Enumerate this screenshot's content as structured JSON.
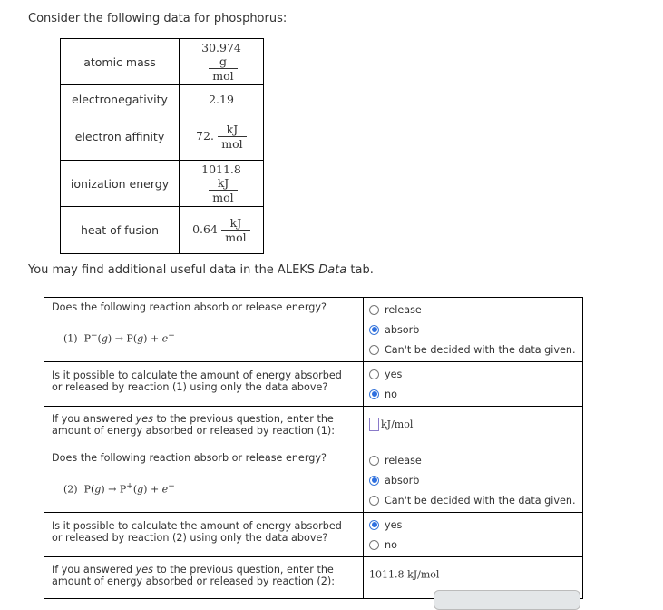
{
  "intro": "Consider the following data for phosphorus:",
  "data_table": [
    {
      "label": "atomic mass",
      "value": "30.974",
      "unit_num": "g",
      "unit_den": "mol"
    },
    {
      "label": "electronegativity",
      "value": "2.19",
      "unit_num": "",
      "unit_den": ""
    },
    {
      "label": "electron affinity",
      "value": "72.",
      "unit_num": "kJ",
      "unit_den": "mol"
    },
    {
      "label": "ionization energy",
      "value": "1011.8",
      "unit_num": "kJ",
      "unit_den": "mol"
    },
    {
      "label": "heat of fusion",
      "value": "0.64",
      "unit_num": "kJ",
      "unit_den": "mol"
    }
  ],
  "note": {
    "prefix": "You may find additional useful data in the ALEKS ",
    "italic": "Data",
    "suffix": " tab."
  },
  "questions": {
    "q1": {
      "prompt": "Does the following reaction absorb or release energy?",
      "reaction_num": "(1)",
      "reaction": {
        "reactant": "P",
        "reactant_charge": "−",
        "product": "P",
        "product_charge": "",
        "electron": "e",
        "electron_charge": "−",
        "phase": "g",
        "arrow": "→",
        "plus": "+"
      },
      "options": [
        "release",
        "absorb",
        "Can't be decided with the data given."
      ],
      "selected": 1
    },
    "q2": {
      "prompt": "Is it possible to calculate the amount of energy absorbed or released by reaction (1) using only the data above?",
      "options": [
        "yes",
        "no"
      ],
      "selected": 1
    },
    "q3": {
      "prompt_pre": "If you answered ",
      "prompt_italic": "yes",
      "prompt_post": " to the previous question, enter the amount of energy absorbed or released by reaction (1):",
      "value": "",
      "unit": "kJ/mol"
    },
    "q4": {
      "prompt": "Does the following reaction absorb or release energy?",
      "reaction_num": "(2)",
      "reaction": {
        "reactant": "P",
        "reactant_charge": "",
        "product": "P",
        "product_charge": "+",
        "electron": "e",
        "electron_charge": "−",
        "phase": "g",
        "arrow": "→",
        "plus": "+"
      },
      "options": [
        "release",
        "absorb",
        "Can't be decided with the data given."
      ],
      "selected": 1
    },
    "q5": {
      "prompt": "Is it possible to calculate the amount of energy absorbed or released by reaction (2) using only the data above?",
      "options": [
        "yes",
        "no"
      ],
      "selected": 0
    },
    "q6": {
      "prompt_pre": "If you answered ",
      "prompt_italic": "yes",
      "prompt_post": " to the previous question, enter the amount of energy absorbed or released by reaction (2):",
      "value": "1011.8",
      "unit": "kJ/mol"
    }
  }
}
